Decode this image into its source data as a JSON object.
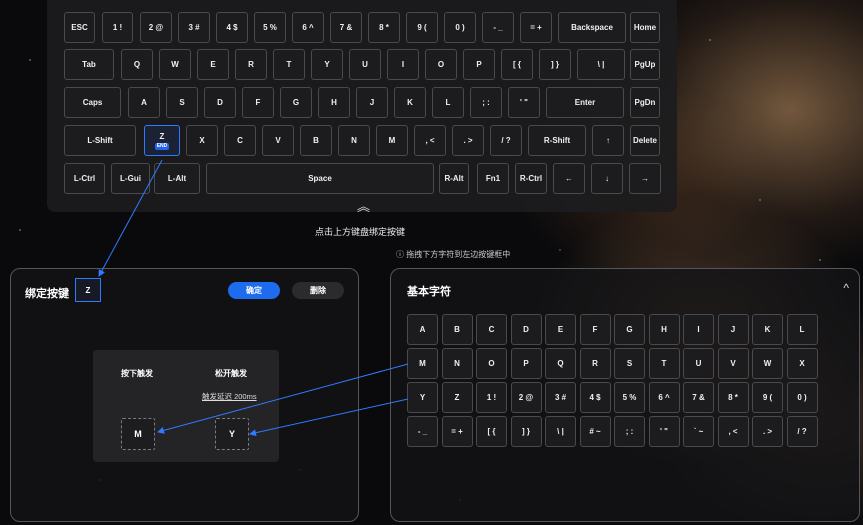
{
  "keyboard": {
    "rows": [
      [
        "ESC",
        "1 !",
        "2 @",
        "3 #",
        "4 $",
        "5 %",
        "6 ^",
        "7 &",
        "8 *",
        "9 (",
        "0 )",
        "- _",
        "= +",
        "Backspace",
        "Home"
      ],
      [
        "Tab",
        "Q",
        "W",
        "E",
        "R",
        "T",
        "Y",
        "U",
        "I",
        "O",
        "P",
        "[ {",
        "] }",
        "\\ |",
        "PgUp"
      ],
      [
        "Caps",
        "A",
        "S",
        "D",
        "F",
        "G",
        "H",
        "J",
        "K",
        "L",
        "; :",
        "' \"",
        "Enter",
        "PgDn"
      ],
      [
        "L-Shift",
        "Z",
        "X",
        "C",
        "V",
        "B",
        "N",
        "M",
        ", <",
        ". >",
        "/ ?",
        "R-Shift",
        "↑",
        "Delete"
      ],
      [
        "L-Ctrl",
        "L-Gui",
        "L-Alt",
        "Space",
        "R-Alt",
        "Fn1",
        "R-Ctrl",
        "←",
        "↓",
        "→"
      ]
    ],
    "selected_key": "Z",
    "selected_badge": "END",
    "collapse_icon": "chevron-double-up-icon",
    "collapse_glyph": "︽",
    "hint": "点击上方键盘绑定按键"
  },
  "drag_hint": "ⓘ 拖拽下方字符到左边按键框中",
  "binding": {
    "title": "绑定按键",
    "key": "Z",
    "confirm_label": "确定",
    "delete_label": "删除",
    "press_label": "按下触发",
    "release_label": "松开触发",
    "delay_label": "触发延迟 200ms",
    "press_value": "M",
    "release_value": "Y"
  },
  "basic_chars": {
    "title": "基本字符",
    "collapse_glyph": "^",
    "rows": [
      [
        "A",
        "B",
        "C",
        "D",
        "E",
        "F",
        "G",
        "H",
        "I",
        "J",
        "K",
        "L"
      ],
      [
        "M",
        "N",
        "O",
        "P",
        "Q",
        "R",
        "S",
        "T",
        "U",
        "V",
        "W",
        "X"
      ],
      [
        "Y",
        "Z",
        "1 !",
        "2 @",
        "3 #",
        "4 $",
        "5 %",
        "6 ^",
        "7 &",
        "8 *",
        "9 (",
        "0 )"
      ],
      [
        "- _",
        "= +",
        "[ {",
        "] }",
        "\\ |",
        "# ~",
        "; :",
        "' \"",
        "` ~",
        ", <",
        ". >",
        "/ ?"
      ]
    ]
  },
  "colors": {
    "accent": "#1d6cf0",
    "arrow": "#2f7bff"
  }
}
